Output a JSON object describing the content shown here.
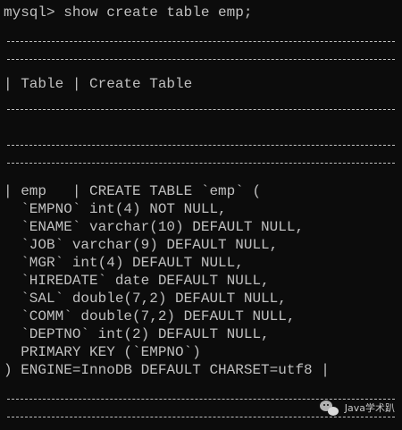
{
  "terminal": {
    "prompt": "mysql> show create table emp;",
    "header_border": "+-------+",
    "header_row": "| Table | Create Table",
    "row_border": "+-------+",
    "body": [
      "| emp   | CREATE TABLE `emp` (",
      "  `EMPNO` int(4) NOT NULL,",
      "  `ENAME` varchar(10) DEFAULT NULL,",
      "  `JOB` varchar(9) DEFAULT NULL,",
      "  `MGR` int(4) DEFAULT NULL,",
      "  `HIREDATE` date DEFAULT NULL,",
      "  `SAL` double(7,2) DEFAULT NULL,",
      "  `COMM` double(7,2) DEFAULT NULL,",
      "  `DEPTNO` int(2) DEFAULT NULL,",
      "  PRIMARY KEY (`EMPNO`)",
      ") ENGINE=InnoDB DEFAULT CHARSET=utf8 |"
    ],
    "footer_border": "+-------+"
  },
  "watermark": {
    "label": "Java学术趴"
  }
}
